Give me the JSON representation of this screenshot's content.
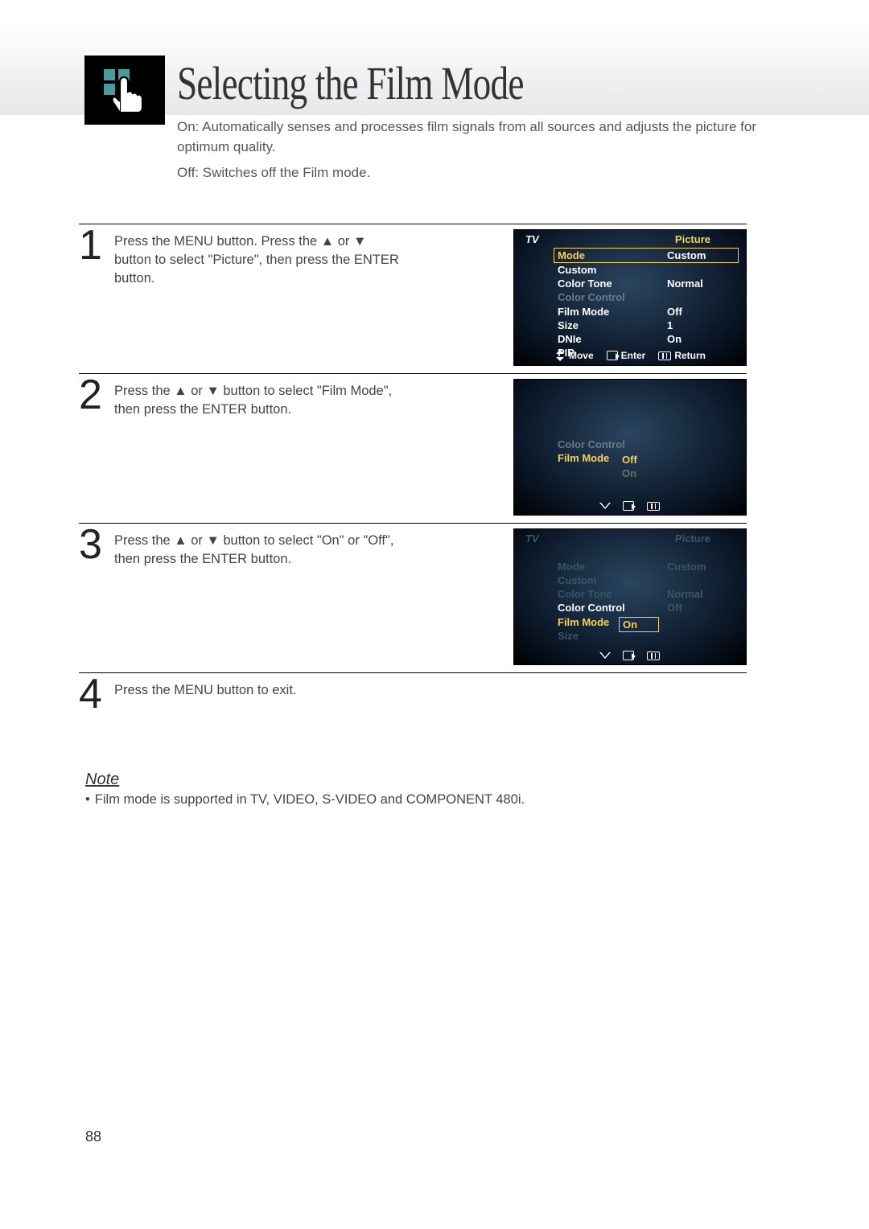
{
  "title": "Selecting the Film Mode",
  "intro_on": "On: Automatically senses and processes film signals from all sources and adjusts the picture for optimum quality.",
  "intro_off": "Off: Switches off the Film mode.",
  "steps": [
    {
      "num": "1",
      "text": "Press the MENU button. Press the ▲ or ▼ button to select \"Picture\", then press the ENTER button."
    },
    {
      "num": "2",
      "text": "Press the ▲ or ▼ button to select \"Film Mode\", then press the ENTER button."
    },
    {
      "num": "3",
      "text": "Press the ▲ or ▼ button to select \"On\" or \"Off\", then press the ENTER button."
    },
    {
      "num": "4",
      "text": "Press the MENU button to exit."
    }
  ],
  "osd1": {
    "tv": "TV",
    "menu_title": "Picture",
    "rows": [
      {
        "lbl": "Mode",
        "val": "Custom",
        "hl": true
      },
      {
        "lbl": "Custom",
        "val": ""
      },
      {
        "lbl": "Color Tone",
        "val": "Normal"
      },
      {
        "lbl": "Color Control",
        "val": "",
        "dim": true
      },
      {
        "lbl": "Film Mode",
        "val": "Off"
      },
      {
        "lbl": "Size",
        "val": "1"
      },
      {
        "lbl": "DNIe",
        "val": "On"
      },
      {
        "lbl": "PIP",
        "val": ""
      }
    ],
    "foot": {
      "move": "Move",
      "enter": "Enter",
      "return": "Return"
    }
  },
  "osd2": {
    "rows": [
      {
        "lbl": "Color Control",
        "val": "",
        "dim": true
      },
      {
        "lbl": "Film Mode",
        "val": "",
        "sel": true
      }
    ],
    "opts": [
      {
        "t": "Off",
        "hl": true
      },
      {
        "t": "On",
        "dim": true
      }
    ]
  },
  "osd3": {
    "tv": "TV",
    "menu_title": "Picture",
    "rows": [
      {
        "lbl": "Mode",
        "val": "Custom",
        "muted": true
      },
      {
        "lbl": "Custom",
        "val": "",
        "muted": true
      },
      {
        "lbl": "Color Tone",
        "val": "Normal",
        "muted": true
      },
      {
        "lbl": "Color Control",
        "val": "Off",
        "keep": true
      },
      {
        "lbl": "Film Mode",
        "val": "",
        "sel": true
      },
      {
        "lbl": "Size",
        "val": "",
        "muted": true
      }
    ],
    "opt_sel": "On"
  },
  "note_title": "Note",
  "note_body": "Film mode is supported in TV, VIDEO, S-VIDEO and COMPONENT 480i.",
  "page_num": "88"
}
